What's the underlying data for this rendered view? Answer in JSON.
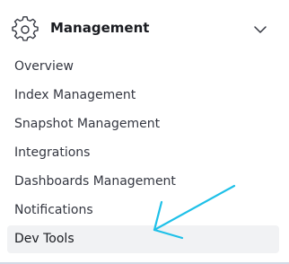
{
  "section": {
    "title": "Management",
    "icon": "gear-icon",
    "toggle_icon": "chevron-down-icon"
  },
  "nav": {
    "items": [
      {
        "label": "Overview"
      },
      {
        "label": "Index Management"
      },
      {
        "label": "Snapshot Management"
      },
      {
        "label": "Integrations"
      },
      {
        "label": "Dashboards Management"
      },
      {
        "label": "Notifications"
      },
      {
        "label": "Dev Tools",
        "active": true
      }
    ]
  },
  "annotation": {
    "arrow_color": "#1ec0e8",
    "points_to": "Dev Tools"
  },
  "colors": {
    "text": "#343741",
    "heading": "#1a1c21",
    "active_bg": "#f1f2f4",
    "icon": "#343741"
  }
}
